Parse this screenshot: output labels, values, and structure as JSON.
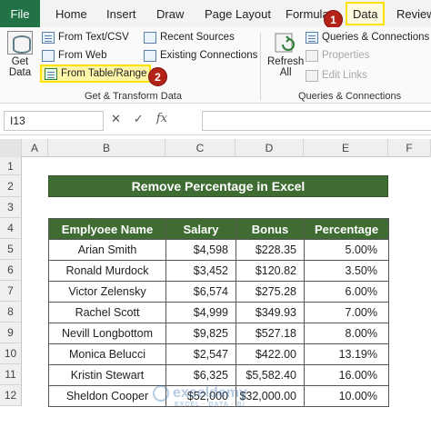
{
  "tabs": {
    "file": "File",
    "home": "Home",
    "insert": "Insert",
    "draw": "Draw",
    "page_layout": "Page Layout",
    "formulas": "Formulas",
    "data": "Data",
    "review": "Review"
  },
  "badges": {
    "one": "1",
    "two": "2"
  },
  "ribbon": {
    "get_data_line1": "Get",
    "get_data_line2": "Data",
    "from_text_csv": "From Text/CSV",
    "from_web": "From Web",
    "from_table_range": "From Table/Range",
    "recent_sources": "Recent Sources",
    "existing_connections": "Existing Connections",
    "group_get_transform": "Get & Transform Data",
    "refresh_line1": "Refresh",
    "refresh_line2": "All",
    "queries_connections": "Queries & Connections",
    "properties": "Properties",
    "edit_links": "Edit Links",
    "group_queries": "Queries & Connections"
  },
  "formula_bar": {
    "name_box": "I13",
    "fx": "fx",
    "value": ""
  },
  "columns": [
    "A",
    "B",
    "C",
    "D",
    "E",
    "F"
  ],
  "rows": [
    "1",
    "2",
    "3",
    "4",
    "5",
    "6",
    "7",
    "8",
    "9",
    "10",
    "11",
    "12"
  ],
  "sheet": {
    "title": "Remove Percentage in Excel",
    "headers": [
      "Emplyoee Name",
      "Salary",
      "Bonus",
      "Percentage"
    ],
    "records": [
      [
        "Arian Smith",
        "$4,598",
        "$228.35",
        "5.00%"
      ],
      [
        "Ronald Murdock",
        "$3,452",
        "$120.82",
        "3.50%"
      ],
      [
        "Victor Zelensky",
        "$6,574",
        "$275.28",
        "6.00%"
      ],
      [
        "Rachel Scott",
        "$4,999",
        "$349.93",
        "7.00%"
      ],
      [
        "Nevill Longbottom",
        "$9,825",
        "$527.18",
        "8.00%"
      ],
      [
        "Monica Belucci",
        "$2,547",
        "$422.00",
        "13.19%"
      ],
      [
        "Kristin Stewart",
        "$6,325",
        "$5,582.40",
        "16.00%"
      ],
      [
        "Sheldon Cooper",
        "$52,000",
        "$32,000.00",
        "10.00%"
      ]
    ]
  },
  "watermark": {
    "name": "exceldemy",
    "tagline": "EXCEL · DATA · BI"
  },
  "colors": {
    "excel_green": "#217346",
    "header_green": "#3f6c32",
    "highlight": "#ffe100",
    "badge_red": "#b42318"
  }
}
